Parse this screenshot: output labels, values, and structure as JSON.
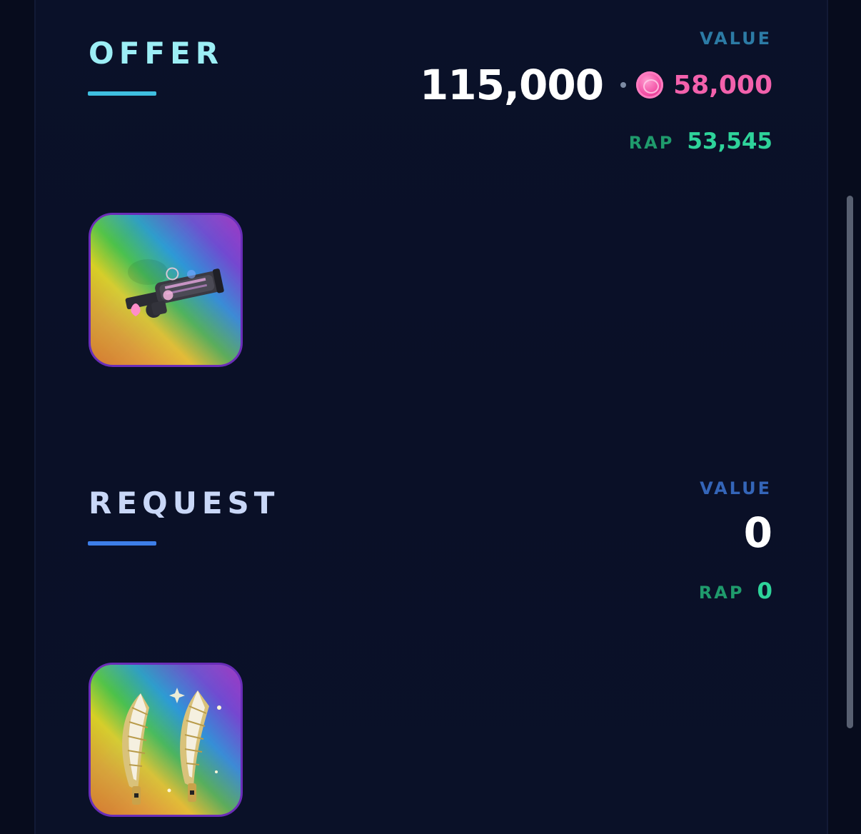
{
  "offer": {
    "title": "OFFER",
    "value_label": "VALUE",
    "value": "115,000",
    "currency_value": "58,000",
    "rap_label": "RAP",
    "rap_value": "53,545",
    "item_icon": "grenade-launcher-icon"
  },
  "request": {
    "title": "REQUEST",
    "value_label": "VALUE",
    "value": "0",
    "rap_label": "RAP",
    "rap_value": "0",
    "item_icon": "golden-wings-icon"
  },
  "colors": {
    "offer_title": "#9ceef5",
    "request_title": "#c9d7f7",
    "rap_value": "#2ed39a",
    "currency_value": "#f261ac",
    "background": "#0a1129"
  }
}
